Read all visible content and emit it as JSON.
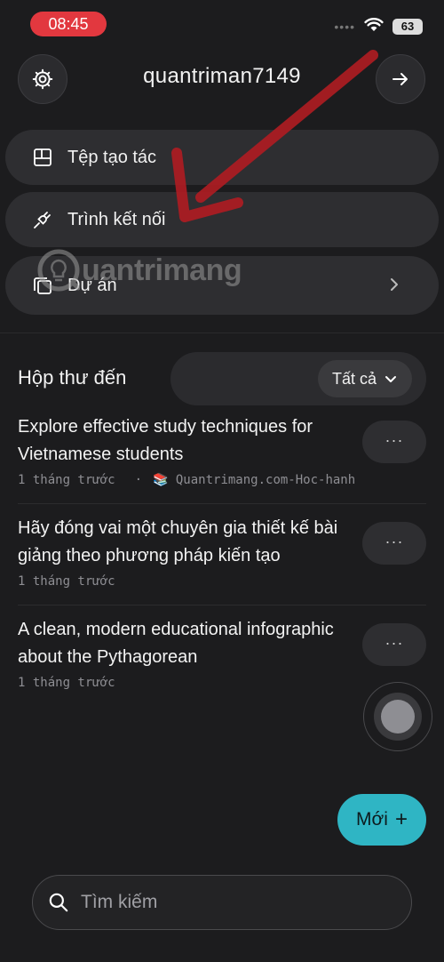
{
  "status_bar": {
    "time": "08:45",
    "dots": "••••",
    "battery": "63"
  },
  "header": {
    "username": "quantriman7149"
  },
  "menu": [
    {
      "label": "Tệp tạo tác"
    },
    {
      "label": "Trình kết nối"
    },
    {
      "label": "Dự án"
    }
  ],
  "watermark": {
    "text": "uantrimang"
  },
  "inbox": {
    "title": "Hộp thư đến",
    "filter_label": "Tất cả",
    "items": [
      {
        "title": "Explore effective study techniques for Vietnamese students",
        "time": "1 tháng trước",
        "sep": "·",
        "project": "📚 Quantrimang.com-Hoc-hanh"
      },
      {
        "title": "Hãy đóng vai một chuyên gia thiết kế bài giảng theo phương pháp kiến tạo",
        "time": "1 tháng trước"
      },
      {
        "title": "A clean, modern educational infographic about the Pythagorean",
        "time": "1 tháng trước"
      }
    ],
    "more_label": "···"
  },
  "new_button": {
    "label": "Mới",
    "icon": "+"
  },
  "search": {
    "placeholder": "Tìm kiếm"
  },
  "colors": {
    "accent": "#2fb5c4",
    "time_pill": "#e2383f",
    "arrow": "#b01c22",
    "background": "#1c1c1e"
  }
}
